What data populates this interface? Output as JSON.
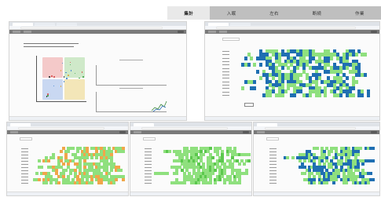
{
  "nav": {
    "tabs": [
      {
        "label": "集計",
        "active": true
      },
      {
        "label": "入眠",
        "active": false
      },
      {
        "label": "左右",
        "active": false
      },
      {
        "label": "断続",
        "active": false
      },
      {
        "label": "作業",
        "active": false
      }
    ]
  },
  "colors": {
    "tab_strip": "#bfbfbf",
    "tab_active": "#e9e9e9",
    "heat_green": "#8fe07e",
    "heat_blue": "#1f6fb2",
    "heat_orange": "#f0a64a",
    "quad_red": "#f4c9c9",
    "quad_green": "#cfe9c9",
    "quad_blue": "#c9d8f2",
    "quad_yellow": "#f3e6b8"
  },
  "windows": [
    {
      "id": "summary",
      "heat_palette": "none",
      "icon": "scatter-chart-icon"
    },
    {
      "id": "heatmap-mixed",
      "heat_palette": "green-blue",
      "icon": "heatmap-icon"
    },
    {
      "id": "heatmap-orange",
      "heat_palette": "green-orange",
      "icon": "heatmap-icon"
    },
    {
      "id": "heatmap-green",
      "heat_palette": "green",
      "icon": "heatmap-icon"
    },
    {
      "id": "heatmap-blue",
      "heat_palette": "green-blue",
      "icon": "heatmap-icon"
    }
  ]
}
